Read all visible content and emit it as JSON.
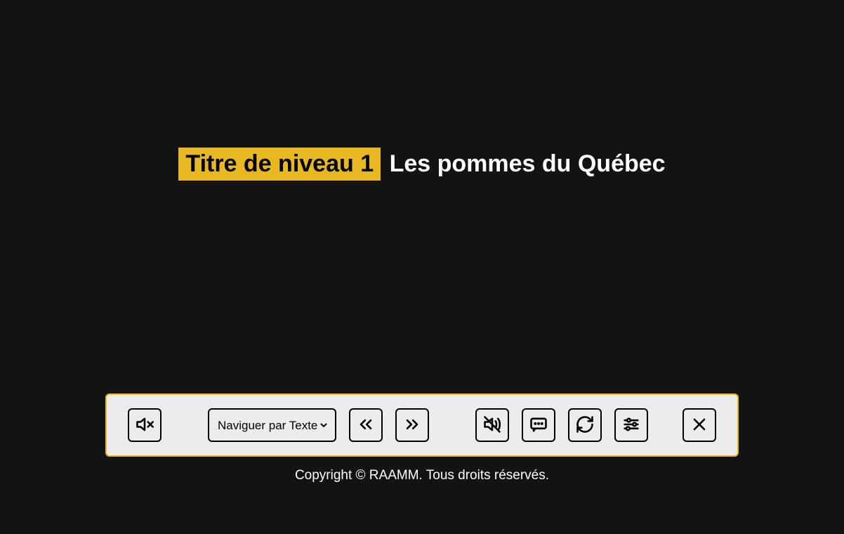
{
  "heading": {
    "tag_label": "Titre de niveau 1",
    "text": "Les pommes du Québec"
  },
  "toolbar": {
    "nav_select": {
      "selected": "Naviguer par Texte"
    }
  },
  "footer": {
    "copyright": "Copyright © RAAMM. Tous droits réservés."
  }
}
